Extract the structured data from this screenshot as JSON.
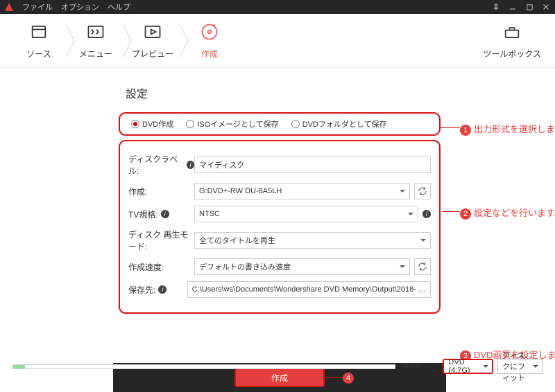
{
  "menu": {
    "file": "ファイル",
    "option": "オプション",
    "help": "ヘルプ"
  },
  "steps": {
    "source": "ソース",
    "menu": "メニュー",
    "preview": "プレビュー",
    "create": "作成"
  },
  "toolbox": {
    "label": "ツールボックス"
  },
  "panel": {
    "title": "設定",
    "output": {
      "dvd": "DVD作成",
      "iso": "ISOイメージとして保存",
      "folder": "DVDフォルダとして保存"
    },
    "rows": {
      "label_disc": "ディスクラベル:",
      "val_disc": "マイディスク",
      "label_burner": "作成:",
      "val_burner": "G:DVD+-RW DU-8A5LH",
      "label_tv": "TV規格:",
      "val_tv": "NTSC",
      "label_play": "ディスク 再生モード:",
      "val_play": "全てのタイトルを再生",
      "label_speed": "作成速度:",
      "val_speed": "デフォルトの書き込み速度",
      "label_save": "保存先:",
      "val_save": "C:\\Users\\ws\\Documents\\Wondershare DVD Memory\\Output\\2018- …"
    }
  },
  "burn": {
    "label": "作成"
  },
  "annotations": {
    "a1": "出力形式を選択します。",
    "a2": "設定などを行います。",
    "a3": "DVD画質を設定します。",
    "n4": "4"
  },
  "bottom": {
    "progress_text": "75M/4.30G",
    "media": "DVD (4.7G)",
    "fit": "ディスクにフィット"
  }
}
